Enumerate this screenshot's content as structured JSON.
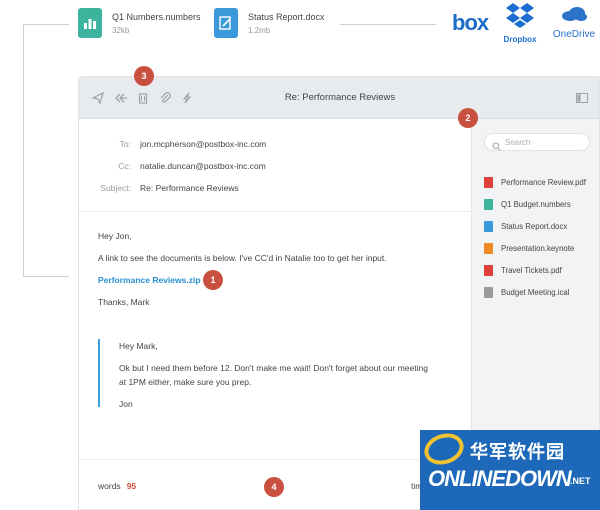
{
  "top_files": [
    {
      "name": "Q1 Numbers.numbers",
      "size": "32kb",
      "icon": "numbers-file-icon",
      "color": "#3db39e"
    },
    {
      "name": "Status Report.docx",
      "size": "1.2mb",
      "icon": "docx-file-icon",
      "color": "#3a9ad9"
    }
  ],
  "brands": {
    "box": "box",
    "dropbox": "Dropbox",
    "onedrive": "OneDrive"
  },
  "window": {
    "title": "Re: Performance Reviews",
    "toolbar_icons": [
      "send-icon",
      "reply-all-icon",
      "trash-icon",
      "attach-icon",
      "flash-icon",
      "sidebar-toggle-icon"
    ]
  },
  "email": {
    "to_label": "To:",
    "to": "jon.mcpherson@postbox-inc.com",
    "cc_label": "Cc:",
    "cc": "natalie.duncan@postbox-inc.com",
    "subject_label": "Subject:",
    "subject": "Re: Performance Reviews",
    "greeting": "Hey Jon,",
    "line1": "A link to see the documents is below. I've CC'd in Natalie too to get her input.",
    "attachment": "Performance Reviews.zip",
    "signoff": "Thanks, Mark",
    "quote": {
      "greeting": "Hey Mark,",
      "line1": "Ok but I need them before 12. Don't make me wait! Don't forget about our meeting",
      "line2": "at 1PM either, make sure you prep.",
      "sign": "Jon"
    }
  },
  "footer": {
    "words_label": "words",
    "words_count": "95",
    "time_label": "tim"
  },
  "sidebar": {
    "search_placeholder": "Search",
    "files": [
      {
        "name": "Performance Review.pdf",
        "color": "#e0403a"
      },
      {
        "name": "Q1 Budget.numbers",
        "color": "#3db39e"
      },
      {
        "name": "Status Report.docx",
        "color": "#3a9ad9"
      },
      {
        "name": "Presentation.keynote",
        "color": "#f08a24"
      },
      {
        "name": "Travel Tickets.pdf",
        "color": "#e0403a"
      },
      {
        "name": "Budget Meeting.ical",
        "color": "#9a9a9a"
      }
    ]
  },
  "badges": [
    "1",
    "2",
    "3",
    "4"
  ],
  "watermark": {
    "cn": "华军软件园",
    "en": "ONLINEDOWN",
    "net": ".NET"
  }
}
